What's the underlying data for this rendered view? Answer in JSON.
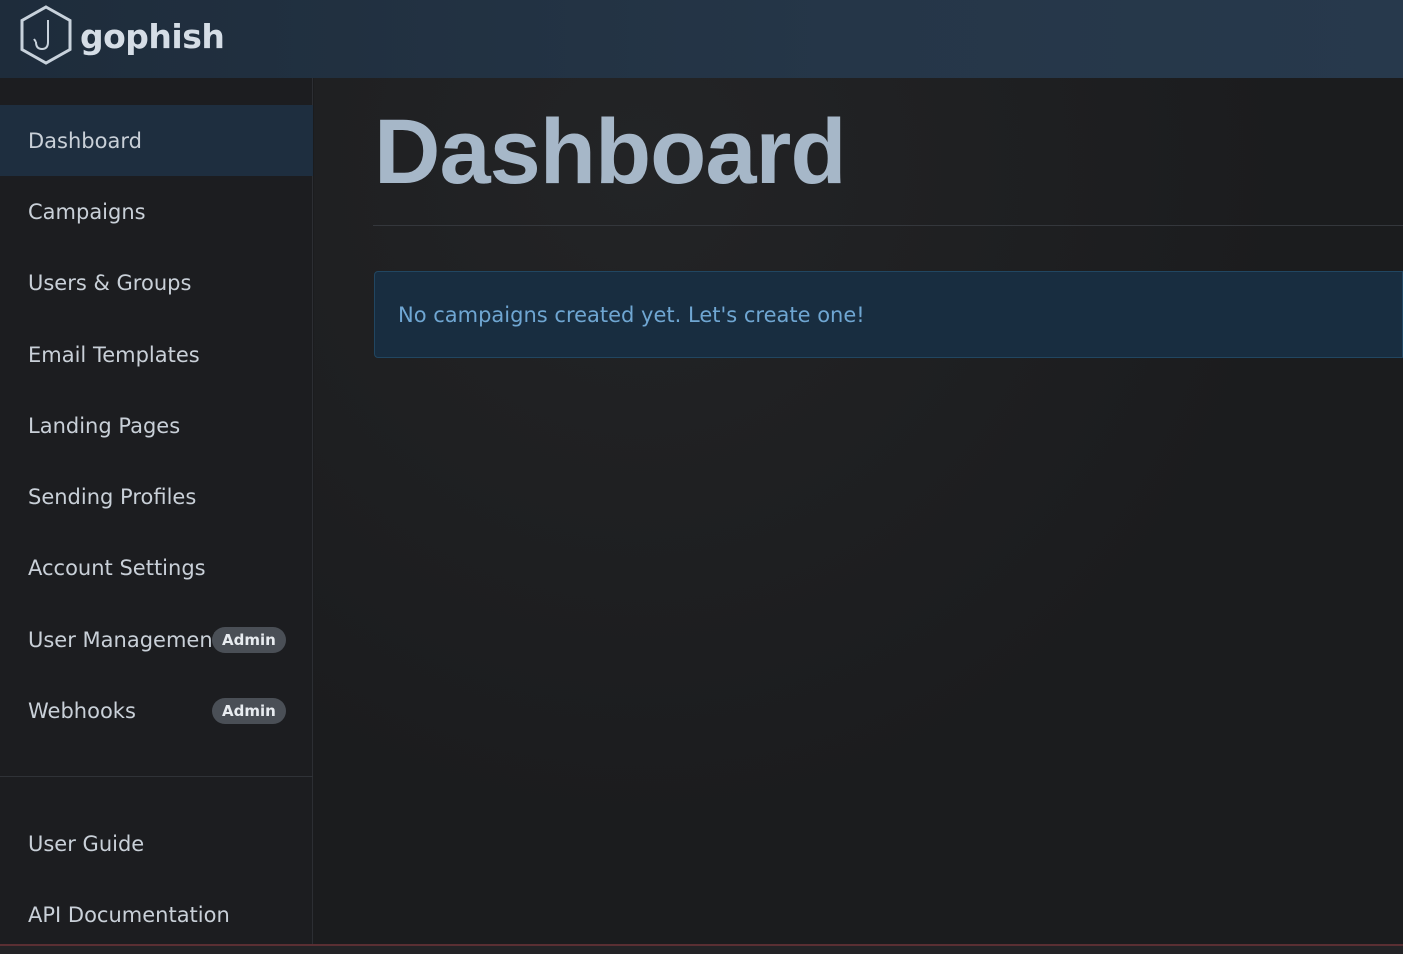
{
  "brand": {
    "name": "gophish",
    "logo_icon": "hexagon-hook-icon"
  },
  "sidebar": {
    "items": [
      {
        "label": "Dashboard",
        "active": true
      },
      {
        "label": "Campaigns"
      },
      {
        "label": "Users & Groups"
      },
      {
        "label": "Email Templates"
      },
      {
        "label": "Landing Pages"
      },
      {
        "label": "Sending Profiles"
      },
      {
        "label": "Account Settings"
      },
      {
        "label": "User Management",
        "badge": "Admin"
      },
      {
        "label": "Webhooks",
        "badge": "Admin"
      }
    ],
    "footer_items": [
      {
        "label": "User Guide"
      },
      {
        "label": "API Documentation"
      }
    ]
  },
  "main": {
    "title": "Dashboard",
    "alert": "No campaigns created yet. Let's create one!"
  },
  "colors": {
    "topbar": "#253648",
    "sidebar_bg": "#1c1d20",
    "active_item": "#1e2e3f",
    "title": "#a6b7c8",
    "alert_bg": "#182d40",
    "alert_text": "#6fa6d2",
    "badge_bg": "#4a4f56"
  }
}
